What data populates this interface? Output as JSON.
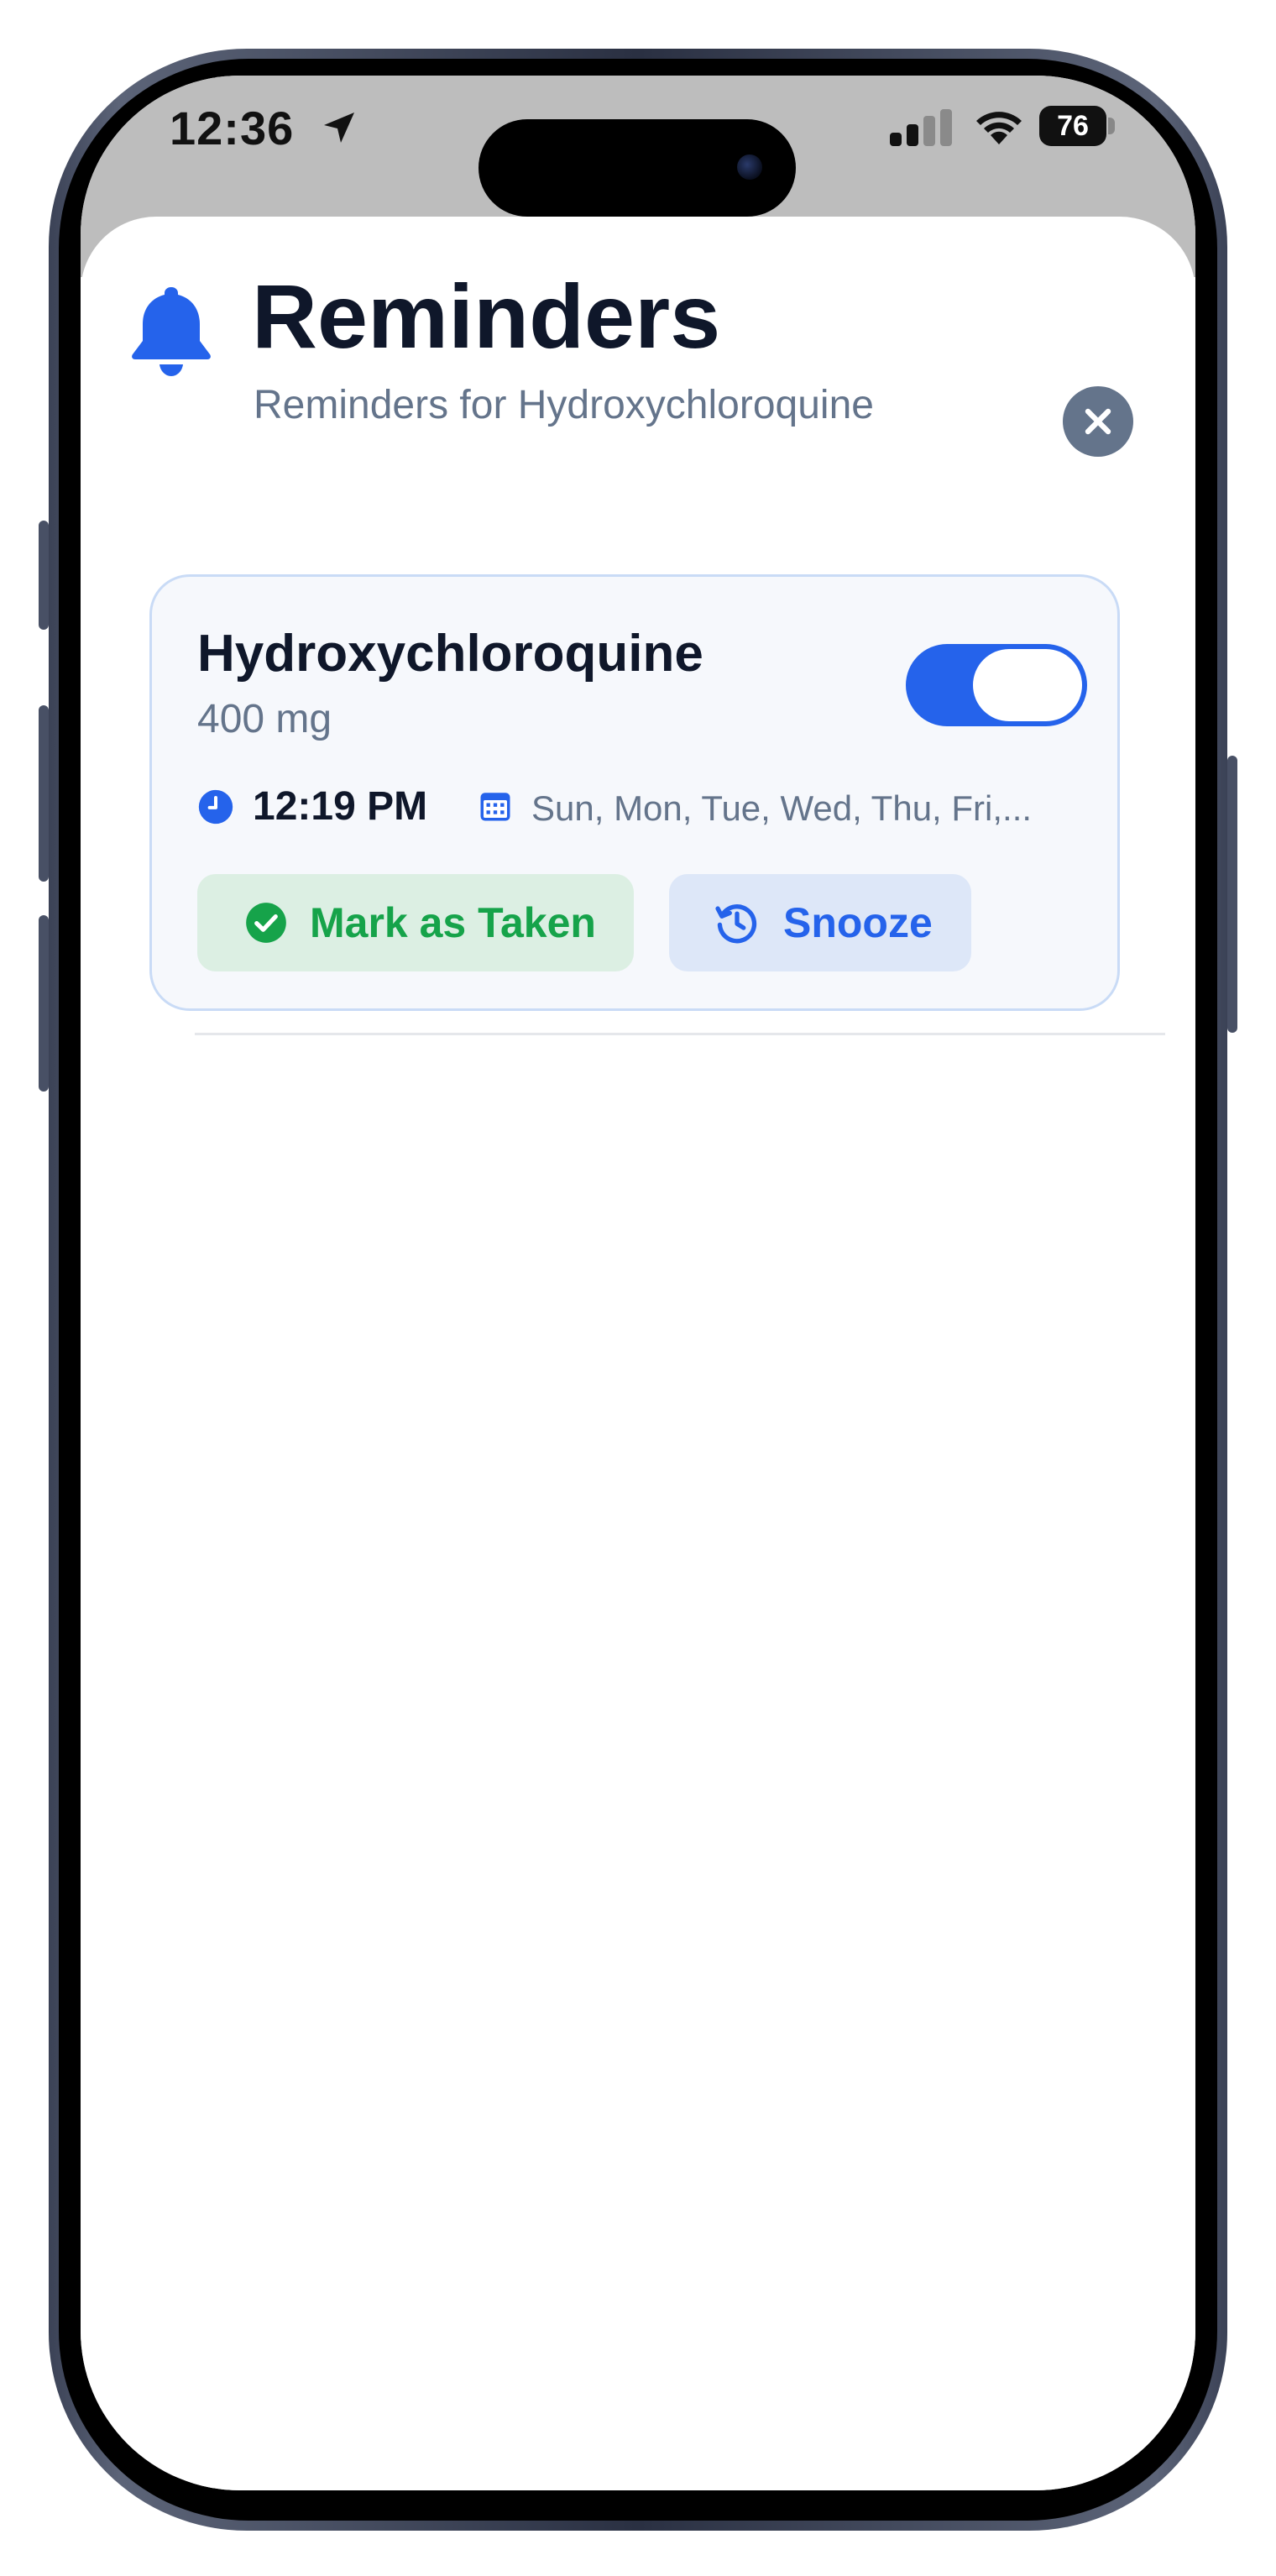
{
  "status_bar": {
    "time": "12:36",
    "battery": "76",
    "icons": [
      "location-arrow-icon",
      "signal-icon",
      "wifi-icon",
      "battery-icon"
    ]
  },
  "header": {
    "icon": "bell-icon",
    "title": "Reminders",
    "subtitle": "Reminders for Hydroxychloroquine",
    "close_icon": "close-icon"
  },
  "reminder": {
    "name": "Hydroxychloroquine",
    "dose": "400 mg",
    "enabled": true,
    "time": "12:19 PM",
    "days": "Sun, Mon, Tue, Wed, Thu, Fri,...",
    "mark_taken_label": "Mark as Taken",
    "snooze_label": "Snooze"
  },
  "colors": {
    "accent": "#2563eb",
    "success": "#16a34a",
    "title": "#0f172a",
    "muted": "#64748b"
  }
}
